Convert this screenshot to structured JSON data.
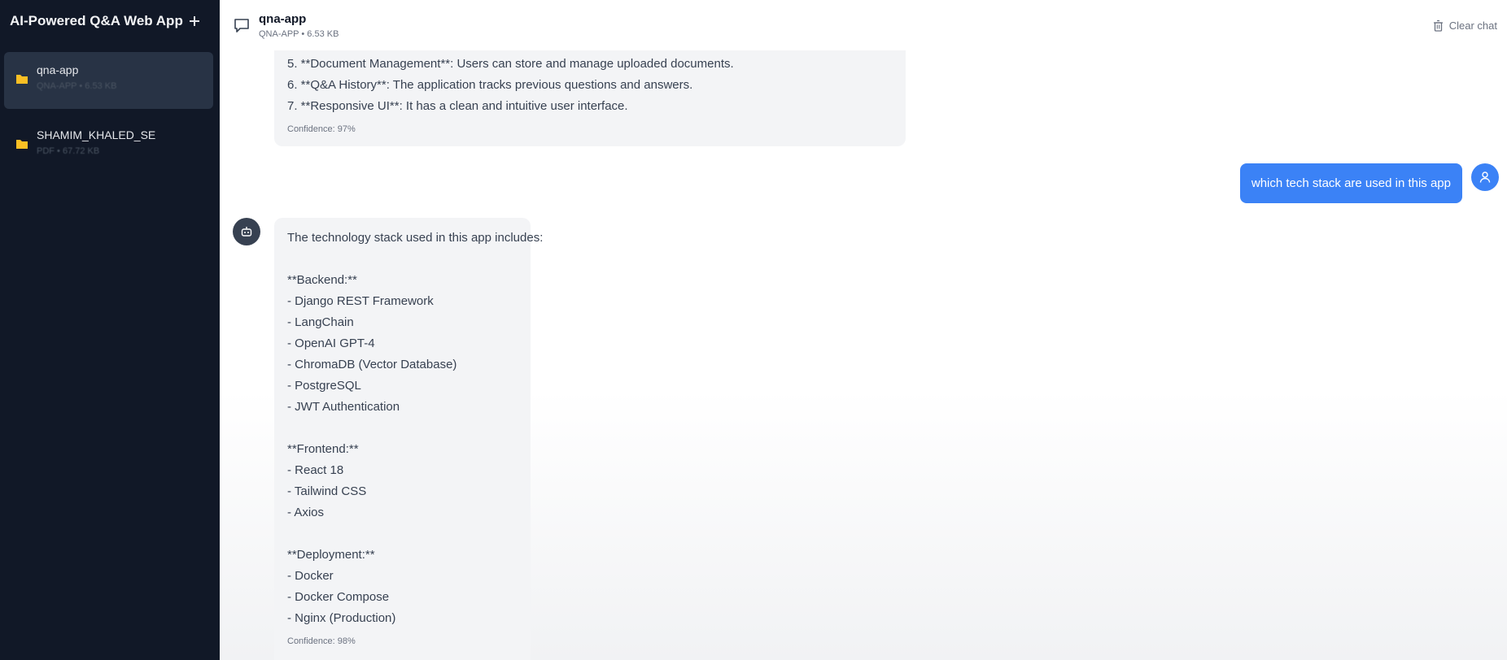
{
  "sidebar": {
    "app_title": "AI-Powered Q&A Web App",
    "documents": [
      {
        "name": "qna-app",
        "meta": "QNA-APP • 6.53 KB",
        "active": true
      },
      {
        "name": "SHAMIM_KHALED_SE",
        "meta": "PDF • 67.72 KB",
        "active": false
      }
    ]
  },
  "header": {
    "title": "qna-app",
    "subtitle": "QNA-APP • 6.53 KB",
    "clear_label": "Clear chat"
  },
  "messages": [
    {
      "role": "assistant",
      "lines": [
        "5. **Document Management**: Users can store and manage uploaded documents.",
        "6. **Q&A History**: The application tracks previous questions and answers.",
        "7. **Responsive UI**: It has a clean and intuitive user interface."
      ],
      "confidence": "Confidence: 97%"
    },
    {
      "role": "user",
      "text": "which tech stack are used in this app"
    },
    {
      "role": "assistant",
      "lines": [
        "The technology stack used in this app includes:",
        "",
        "**Backend:**",
        "- Django REST Framework",
        "- LangChain",
        "- OpenAI GPT-4",
        "- ChromaDB (Vector Database)",
        "- PostgreSQL",
        "- JWT Authentication",
        "",
        "**Frontend:**",
        "- React 18",
        "- Tailwind CSS",
        "- Axios",
        "",
        "**Deployment:**",
        "- Docker",
        "- Docker Compose",
        "- Nginx (Production)"
      ],
      "confidence": "Confidence: 98%"
    }
  ],
  "colors": {
    "sidebar_bg": "#111827",
    "sidebar_active": "#283345",
    "user_bubble": "#3b82f6",
    "assistant_bubble": "#f3f4f6",
    "folder": "#fbbf24"
  }
}
